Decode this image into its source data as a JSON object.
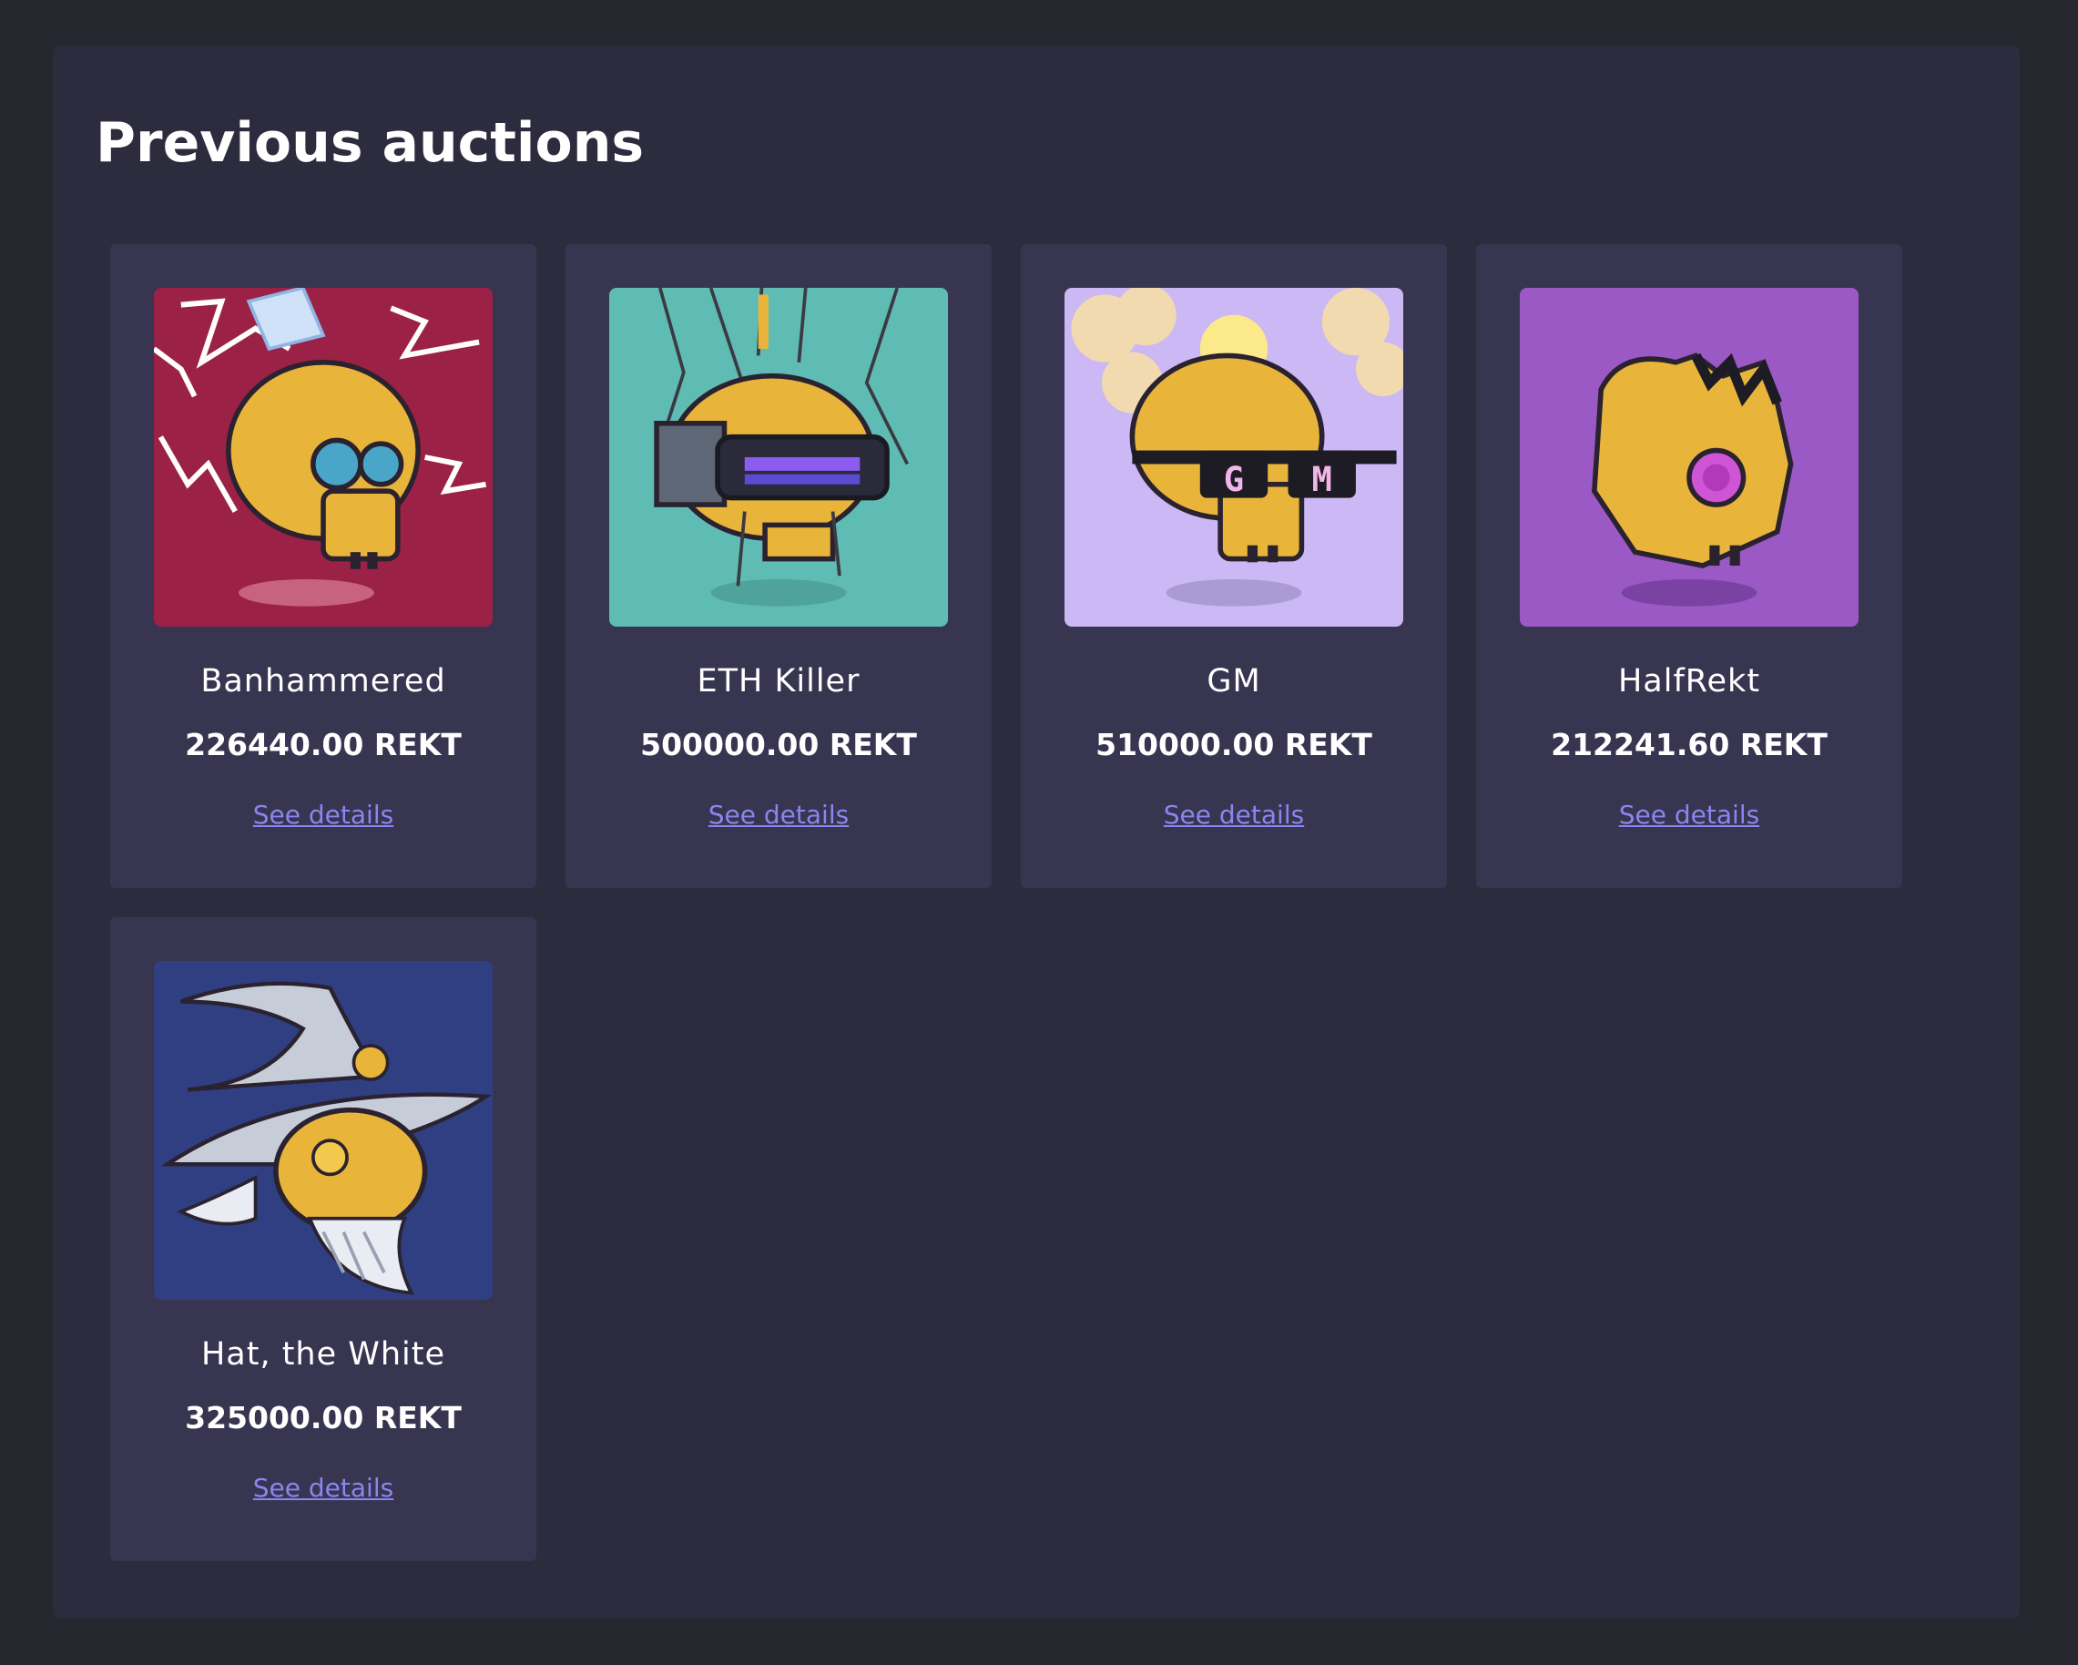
{
  "page": {
    "title": "Previous auctions"
  },
  "auctions": [
    {
      "name": "Banhammered",
      "price": "226440.00 REKT",
      "link_label": "See details",
      "art_bg": "#9c2146"
    },
    {
      "name": "ETH Killer",
      "price": "500000.00 REKT",
      "link_label": "See details",
      "art_bg": "#5fbcb4"
    },
    {
      "name": "GM",
      "price": "510000.00 REKT",
      "link_label": "See details",
      "art_bg": "#cbb8f4",
      "glasses_text": "G M"
    },
    {
      "name": "HalfRekt",
      "price": "212241.60 REKT",
      "link_label": "See details",
      "art_bg": "#9b59c6"
    },
    {
      "name": "Hat, the White",
      "price": "325000.00 REKT",
      "link_label": "See details",
      "art_bg": "#2f3f82"
    }
  ]
}
